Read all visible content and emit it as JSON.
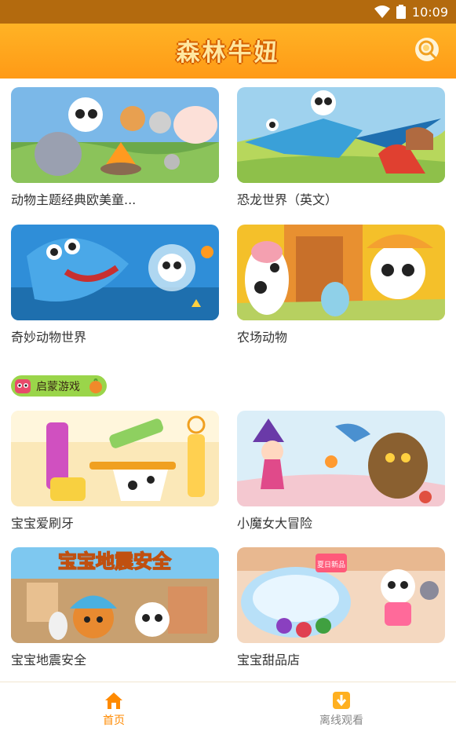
{
  "status": {
    "time": "10:09"
  },
  "header": {
    "title": "森林牛妞"
  },
  "videos": [
    {
      "title": "动物主题经典欧美童..."
    },
    {
      "title": "恐龙世界（英文）"
    },
    {
      "title": "奇妙动物世界"
    },
    {
      "title": "农场动物"
    }
  ],
  "games_section": {
    "label": "启蒙游戏"
  },
  "games": [
    {
      "title": "宝宝爱刷牙"
    },
    {
      "title": "小魔女大冒险"
    },
    {
      "title": "宝宝地震安全"
    },
    {
      "title": "宝宝甜品店"
    }
  ],
  "tabs": [
    {
      "label": "首页",
      "active": true
    },
    {
      "label": "离线观看",
      "active": false
    }
  ],
  "thumb_text": {
    "earthquake_banner": "宝宝地震安全",
    "dessert_badge": "夏日新品"
  },
  "colors": {
    "accent": "#ff9a16",
    "active_tab": "#ff8a00",
    "inactive_tab": "#888888",
    "pill": "#9ad54a"
  }
}
